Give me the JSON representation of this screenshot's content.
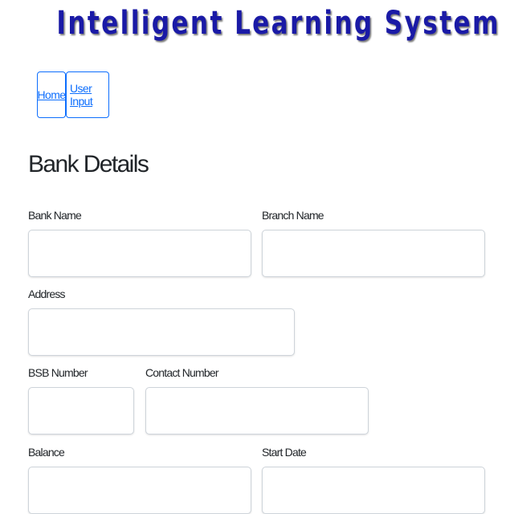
{
  "header": {
    "title": "Intelligent Learning System"
  },
  "nav": {
    "home_label": "Home",
    "user_input_label": "User Input"
  },
  "form": {
    "title": "Bank Details",
    "fields": {
      "bank_name": {
        "label": "Bank Name",
        "value": ""
      },
      "branch_name": {
        "label": "Branch Name",
        "value": ""
      },
      "address": {
        "label": "Address",
        "value": ""
      },
      "bsb_number": {
        "label": "BSB Number",
        "value": ""
      },
      "contact_number": {
        "label": "Contact Number",
        "value": ""
      },
      "balance": {
        "label": "Balance",
        "value": ""
      },
      "start_date": {
        "label": "Start Date",
        "value": ""
      }
    }
  },
  "colors": {
    "title": "#1a1aa6",
    "link": "#0d6efd",
    "input_border": "#ced4da"
  }
}
